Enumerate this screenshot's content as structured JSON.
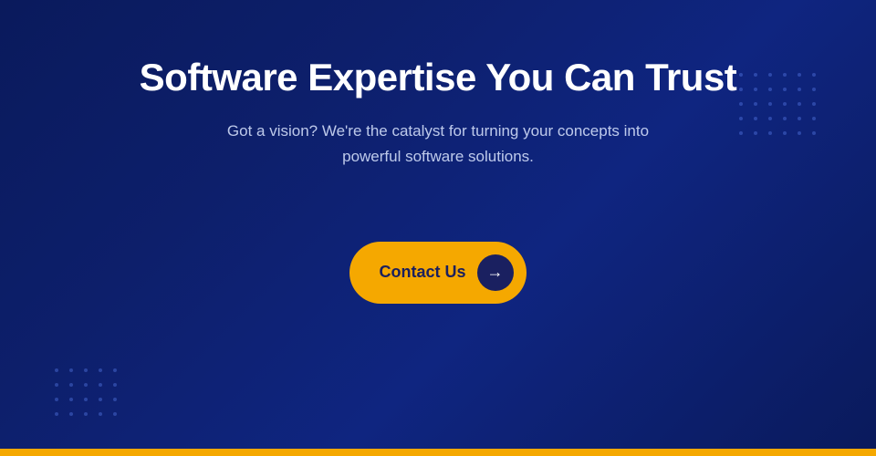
{
  "hero": {
    "title": "Software Expertise You Can Trust",
    "subtitle": "Got a vision? We're the catalyst for turning your concepts into powerful software solutions.",
    "cta_label": "Contact Us",
    "cta_arrow": "→"
  },
  "colors": {
    "background_dark": "#0a1a5c",
    "accent_yellow": "#f5a800",
    "text_white": "#ffffff",
    "bottom_bar": "#f5a800"
  }
}
